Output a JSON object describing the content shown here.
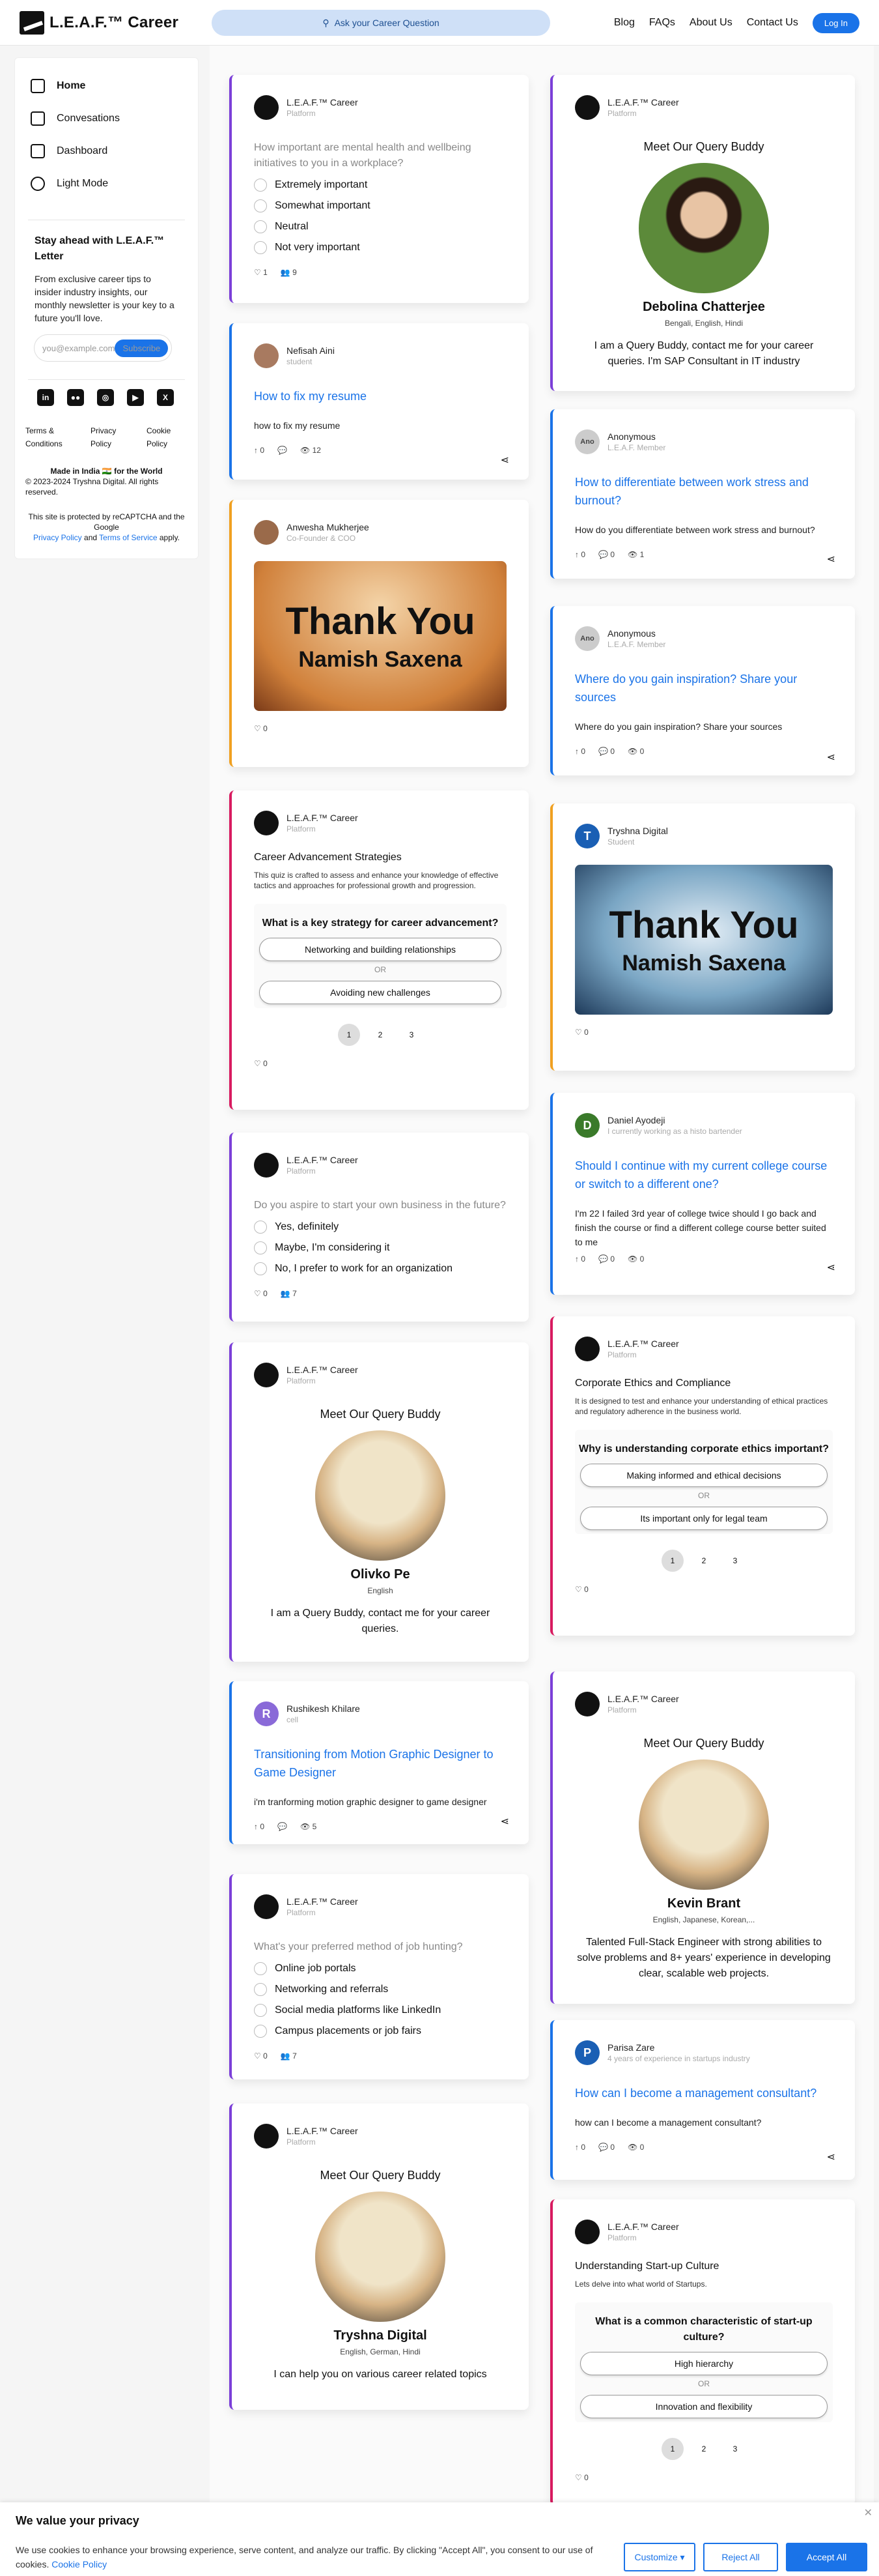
{
  "header": {
    "logo": "L.E.A.F.™ Career",
    "search": "Ask your Career Question",
    "nav": [
      "Blog",
      "FAQs",
      "About Us",
      "Contact Us"
    ],
    "login": "Log In"
  },
  "sidebar": {
    "items": [
      "Home",
      "Convesations",
      "Dashboard",
      "Light Mode"
    ],
    "newsletter_title": "Stay ahead with L.E.A.F.™ Letter",
    "newsletter_text": "From exclusive career tips to insider industry insights, our monthly newsletter is your key to a future you'll love.",
    "email_placeholder": "you@example.com",
    "subscribe": "Subscribe",
    "links": [
      "Terms & Conditions",
      "Privacy Policy",
      "Cookie Policy"
    ],
    "made_in": "Made in India 🇮🇳 for the World",
    "copyright": "© 2023-2024 Tryshna Digital. All rights reserved.",
    "recaptcha_a": "This site is protected by reCAPTCHA and the Google",
    "privacy": "Privacy Policy",
    "and": "and",
    "terms": "Terms of Service",
    "apply": "apply."
  },
  "cards": {
    "poll1": {
      "author": "L.E.A.F.™ Career",
      "role": "Platform",
      "question": "How important are mental health and wellbeing initiatives to you in a workplace?",
      "options": [
        "Extremely important",
        "Somewhat important",
        "Neutral",
        "Not very important"
      ],
      "likes": "1",
      "votes": "9"
    },
    "resume": {
      "author": "Nefisah Aini",
      "role": "student",
      "title": "How to fix my resume",
      "body": "how to fix my resume",
      "up": "0",
      "comments": "",
      "views": "12"
    },
    "thanks1": {
      "author": "Anwesha Mukherjee",
      "role": "Co-Founder & COO",
      "t1": "Thank You",
      "t2": "Namish Saxena",
      "likes": "0"
    },
    "quiz1": {
      "author": "L.E.A.F.™ Career",
      "role": "Platform",
      "title": "Career Advancement Strategies",
      "sub": "This quiz is crafted to assess and enhance your knowledge of effective tactics and approaches for professional growth and progression.",
      "question": "What is a key strategy for career advancement?",
      "opt1": "Networking and building relationships",
      "or": "OR",
      "opt2": "Avoiding new challenges",
      "pages": [
        "1",
        "2",
        "3"
      ],
      "likes": "0"
    },
    "poll2": {
      "author": "L.E.A.F.™ Career",
      "role": "Platform",
      "question": "Do you aspire to start your own business in the future?",
      "options": [
        "Yes, definitely",
        "Maybe, I'm considering it",
        "No, I prefer to work for an organization"
      ],
      "likes": "0",
      "votes": "7"
    },
    "buddy1": {
      "author": "L.E.A.F.™ Career",
      "role": "Platform",
      "heading": "Meet Our Query Buddy",
      "name": "Olivko Pe",
      "lang": "English",
      "desc": "I am a Query Buddy, contact me for your career queries."
    },
    "motion": {
      "author": "Rushikesh Khilare",
      "role": "cell",
      "initial": "R",
      "title": "Transitioning from Motion Graphic Designer to Game Designer",
      "body": "i'm tranforming motion graphic designer to game designer",
      "up": "0",
      "comments": "",
      "views": "5"
    },
    "poll3": {
      "author": "L.E.A.F.™ Career",
      "role": "Platform",
      "question": "What's your preferred method of job hunting?",
      "options": [
        "Online job portals",
        "Networking and referrals",
        "Social media platforms like LinkedIn",
        "Campus placements or job fairs"
      ],
      "likes": "0",
      "votes": "7"
    },
    "buddy2": {
      "author": "L.E.A.F.™ Career",
      "role": "Platform",
      "heading": "Meet Our Query Buddy",
      "name": "Tryshna Digital",
      "lang": "English, German, Hindi",
      "desc": "I can help you on various career related topics"
    },
    "buddy3": {
      "author": "L.E.A.F.™ Career",
      "role": "Platform",
      "heading": "Meet Our Query Buddy",
      "name": "Debolina Chatterjee",
      "lang": "Bengali, English, Hindi",
      "desc": "I am a Query Buddy, contact me for your career queries. I'm SAP Consultant in IT industry"
    },
    "stress": {
      "author": "Anonymous",
      "role": "L.E.A.F. Member",
      "initial": "Ano",
      "title": "How to differentiate between work stress and burnout?",
      "body": "How do you differentiate between work stress and burnout?",
      "up": "0",
      "comments": "0",
      "views": "1"
    },
    "inspire": {
      "author": "Anonymous",
      "role": "L.E.A.F. Member",
      "initial": "Ano",
      "title": "Where do you gain inspiration? Share your sources",
      "body": "Where do you gain inspiration? Share your sources",
      "up": "0",
      "comments": "0",
      "views": "0"
    },
    "thanks2": {
      "author": "Tryshna Digital",
      "role": "Student",
      "initial": "T",
      "t1": "Thank You",
      "t2": "Namish Saxena",
      "likes": "0"
    },
    "college": {
      "author": "Daniel Ayodeji",
      "role": "I currently working as a histo bartender",
      "initial": "D",
      "title": "Should I continue with my current college course or switch to a different one?",
      "body": "I'm 22 I failed 3rd year of college twice should I go back and finish the course or find a different college course better suited to me",
      "up": "0",
      "comments": "0",
      "views": "0"
    },
    "quiz2": {
      "author": "L.E.A.F.™ Career",
      "role": "Platform",
      "title": "Corporate Ethics and Compliance",
      "sub": "It is designed to test and enhance your understanding of ethical practices and regulatory adherence in the business world.",
      "question": "Why is understanding corporate ethics important?",
      "opt1": "Making informed and ethical decisions",
      "or": "OR",
      "opt2": "Its important only for legal team",
      "pages": [
        "1",
        "2",
        "3"
      ],
      "likes": "0"
    },
    "buddy4": {
      "author": "L.E.A.F.™ Career",
      "role": "Platform",
      "heading": "Meet Our Query Buddy",
      "name": "Kevin Brant",
      "lang": "English, Japanese, Korean,...",
      "desc": "Talented Full-Stack Engineer with strong abilities to solve problems and 8+ years' experience in developing clear, scalable web projects."
    },
    "consult": {
      "author": "Parisa Zare",
      "role": "4 years of experience in startups industry",
      "initial": "P",
      "title": "How can I become a management consultant?",
      "body": "how can I become a management consultant?",
      "up": "0",
      "comments": "0",
      "views": "0"
    },
    "quiz3": {
      "author": "L.E.A.F.™ Career",
      "role": "Platform",
      "title": "Understanding Start-up Culture",
      "sub": "Lets delve into what world of Startups.",
      "question": "What is a common characteristic of start-up culture?",
      "opt1": "High hierarchy",
      "or": "OR",
      "opt2": "Innovation and flexibility",
      "pages": [
        "1",
        "2",
        "3"
      ],
      "likes": "0"
    }
  },
  "cookie": {
    "title": "We value your privacy",
    "text": "We use cookies to enhance your browsing experience, serve content, and analyze our traffic. By clicking \"Accept All\", you consent to our use of cookies.",
    "link": "Cookie Policy",
    "customize": "Customize ▾",
    "reject": "Reject All",
    "accept": "Accept All"
  },
  "colors": {
    "accent": "#1a73e8",
    "purple": "#7b3fd8",
    "orange": "#f0a020",
    "red": "#d81b60"
  }
}
